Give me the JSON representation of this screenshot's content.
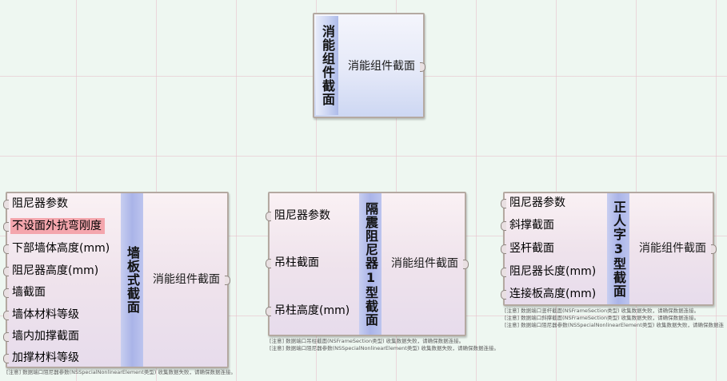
{
  "nodes": {
    "top": {
      "title": "消能组件截面",
      "output": "消能组件截面"
    },
    "wall": {
      "title": "墙板式截面",
      "inputs": [
        "阻尼器参数",
        "不设面外抗弯刚度",
        "下部墙体高度(mm)",
        "阻尼器高度(mm)",
        "墙截面",
        "墙体材料等级",
        "墙内加撑截面",
        "加撑材料等级"
      ],
      "output": "消能组件截面",
      "notes": [
        "[注意] 数据端口阻尼器参数(NSSpecialNonlinearElement类型) 收集数据失败，请确保数据连接。"
      ]
    },
    "iso": {
      "title": "隔震阻尼器1型截面",
      "inputs": [
        "阻尼器参数",
        "吊柱截面",
        "吊柱高度(mm)"
      ],
      "output": "消能组件截面",
      "notes": [
        "[注意] 数据端口吊柱截面(NSFrameSection类型) 收集数据失败，请确保数据连接。",
        "[注意] 数据端口阻尼器参数(NSSpecialNonlinearElement类型) 收集数据失败，请确保数据连接。"
      ]
    },
    "zheng": {
      "title": "正人字3型截面",
      "inputs": [
        "阻尼器参数",
        "斜撑截面",
        "竖杆截面",
        "阻尼器长度(mm)",
        "连接板高度(mm)"
      ],
      "output": "消能组件截面",
      "notes": [
        "[注意] 数据端口竖杆截面(NSFrameSection类型) 收集数据失败，请确保数据连接。",
        "[注意] 数据端口斜撑截面(NSFrameSection类型) 收集数据失败，请确保数据连接。",
        "[注意] 数据端口阻尼器参数(NSSpecialNonlinearElement类型) 收集数据失败，请确保数据连"
      ]
    }
  },
  "colors": {
    "canvas": "#eef7f1",
    "grid": "#e8bec8",
    "title_strip": "#aab4e8",
    "warning_highlight": "#f4a6ad"
  }
}
